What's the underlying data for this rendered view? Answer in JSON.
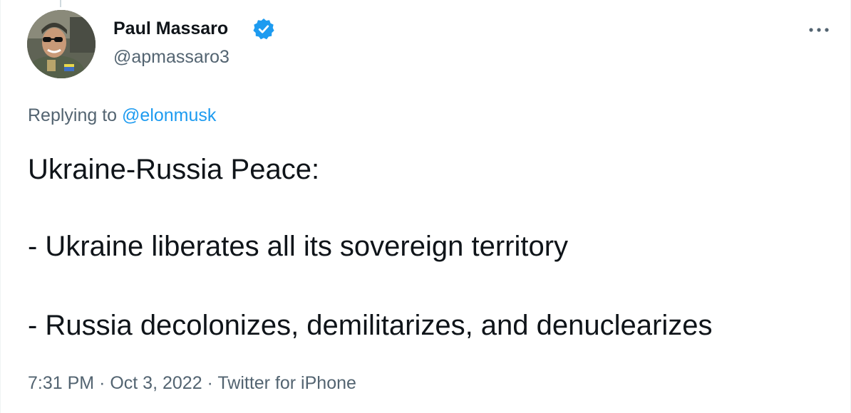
{
  "author": {
    "name": "Paul Massaro",
    "handle": "@apmassaro3",
    "verified": true
  },
  "reply": {
    "prefix": "Replying to",
    "mention": "@elonmusk"
  },
  "tweet": {
    "lines": [
      "Ukraine-Russia Peace:",
      "- Ukraine liberates all its sovereign territory",
      "- Russia decolonizes, demilitarizes, and denuclearizes"
    ]
  },
  "meta": {
    "time": "7:31 PM",
    "separator": "·",
    "date": "Oct 3, 2022",
    "source": "Twitter for iPhone"
  },
  "icons": {
    "verified": "verified-badge-icon",
    "more": "more-horizontal-icon"
  },
  "colors": {
    "text": "#0f1419",
    "secondary": "#536471",
    "accent": "#1d9bf0"
  }
}
